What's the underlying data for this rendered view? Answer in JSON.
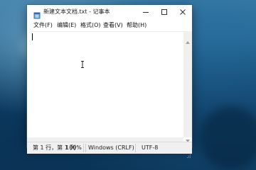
{
  "window": {
    "title": "新建文本文档.txt - 记事本",
    "app_icon": "notepad-icon",
    "controls": {
      "minimize_icon": "minimize-icon",
      "maximize_icon": "maximize-icon",
      "close_icon": "close-icon"
    }
  },
  "menu": {
    "items": [
      {
        "label": "文件(F)"
      },
      {
        "label": "编辑(E)"
      },
      {
        "label": "格式(O)"
      },
      {
        "label": "查看(V)"
      },
      {
        "label": "帮助(H)"
      }
    ]
  },
  "editor": {
    "content": "",
    "cursor_icon": "text-cursor-icon"
  },
  "statusbar": {
    "position": "第 1 行，第 1 列",
    "zoom": "100%",
    "line_ending": "Windows (CRLF)",
    "encoding": "UTF-8"
  }
}
